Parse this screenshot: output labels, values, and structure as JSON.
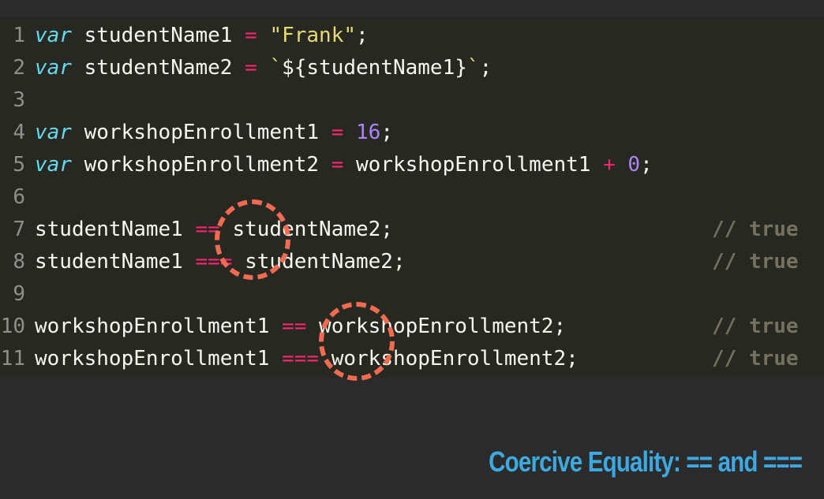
{
  "code": {
    "line_numbers": [
      "1",
      "2",
      "3",
      "4",
      "5",
      "6",
      "7",
      "8",
      "9",
      "10",
      "11"
    ],
    "line1": {
      "kw": "var",
      "ident": " studentName1 ",
      "op": "=",
      "sp": " ",
      "str": "\"Frank\"",
      "end": ";"
    },
    "line2": {
      "kw": "var",
      "ident": " studentName2 ",
      "op": "=",
      "sp": " ",
      "tick_open": "`",
      "tmpl": "${studentName1}",
      "tick_close": "`",
      "end": ";"
    },
    "line4": {
      "kw": "var",
      "ident": " workshopEnrollment1 ",
      "op": "=",
      "sp": " ",
      "num": "16",
      "end": ";"
    },
    "line5": {
      "kw": "var",
      "ident": " workshopEnrollment2 ",
      "op": "=",
      "rest": " workshopEnrollment1 ",
      "op2": "+",
      "sp": " ",
      "num": "0",
      "end": ";"
    },
    "line7": {
      "left": "studentName1 ",
      "op": "==",
      "right": " studentName2;",
      "comment": "// true"
    },
    "line8": {
      "left": "studentName1 ",
      "op": "===",
      "right": " studentName2;",
      "comment": "// true"
    },
    "line10": {
      "left": "workshopEnrollment1 ",
      "op": "==",
      "right": " workshopEnrollment2;",
      "comment": "// true"
    },
    "line11": {
      "left": "workshopEnrollment1 ",
      "op": "===",
      "right": " workshopEnrollment2;",
      "comment": "// true"
    }
  },
  "title": "Coercive Equality: == and ===",
  "colors": {
    "keyword": "#66d9ef",
    "operator": "#f92672",
    "string": "#e6db74",
    "number": "#ae81ff",
    "comment": "#75715e",
    "highlight_circle": "#f26b50",
    "title": "#3ea9e0"
  }
}
